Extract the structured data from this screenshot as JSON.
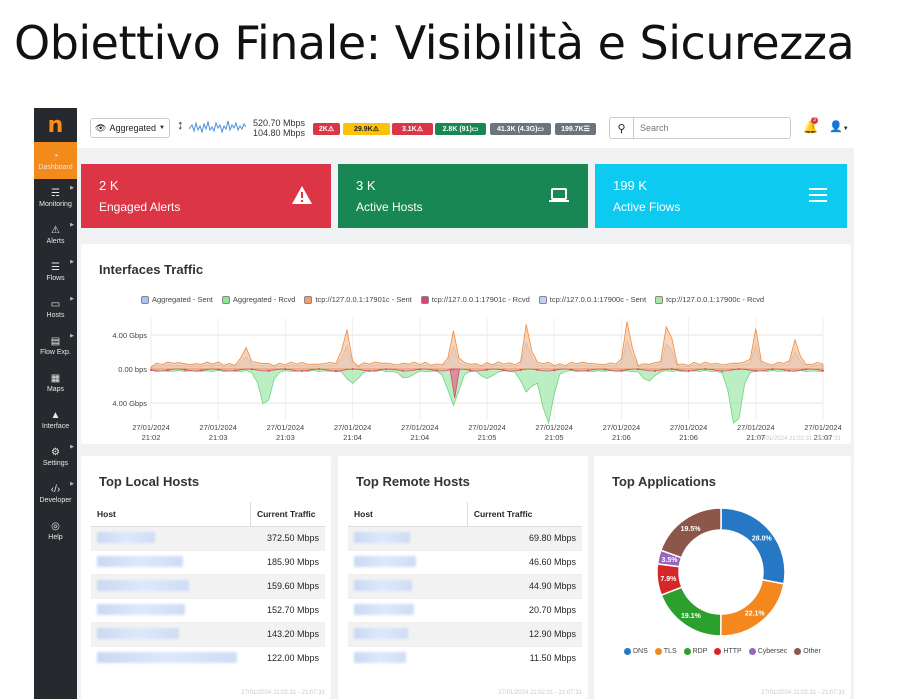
{
  "slide_title": "Obiettivo Finale: Visibilità e Sicurezza",
  "sidebar": {
    "logo": "n",
    "items": [
      {
        "label": "Dashboard",
        "icon": "gauge-icon",
        "active": true
      },
      {
        "label": "Monitoring",
        "icon": "monitoring-icon"
      },
      {
        "label": "Alerts",
        "icon": "warning-icon"
      },
      {
        "label": "Flows",
        "icon": "flows-icon"
      },
      {
        "label": "Hosts",
        "icon": "laptop-icon"
      },
      {
        "label": "Flow Exp.",
        "icon": "file-export-icon"
      },
      {
        "label": "Maps",
        "icon": "map-icon"
      },
      {
        "label": "Interface",
        "icon": "ethernet-icon"
      },
      {
        "label": "Settings",
        "icon": "cog-icon"
      },
      {
        "label": "Developer",
        "icon": "code-icon"
      },
      {
        "label": "Help",
        "icon": "life-ring-icon"
      }
    ]
  },
  "topbar": {
    "interface_selector": "Aggregated",
    "upload": "520.70 Mbps",
    "download": "104.80 Mbps",
    "badges": [
      {
        "label": "2K",
        "icon": "warning-icon",
        "color": "#dc3545"
      },
      {
        "label": "29.9K",
        "icon": "warning-icon",
        "color": "#ffc107"
      },
      {
        "label": "3.1K",
        "icon": "warning-icon",
        "color": "#dc3545"
      },
      {
        "label": "2.8K (91)",
        "icon": "laptop-icon",
        "color": "#198754"
      },
      {
        "label": "41.3K (4.3G)",
        "icon": "laptop-icon",
        "color": "#6c757d"
      },
      {
        "label": "199.7K",
        "icon": "flows-icon",
        "color": "#6c757d"
      }
    ],
    "search_placeholder": "Search",
    "notifications": "3"
  },
  "stats": [
    {
      "value": "2 K",
      "label": "Engaged Alerts",
      "color": "#dc3545",
      "icon": "warning-icon"
    },
    {
      "value": "3 K",
      "label": "Active Hosts",
      "color": "#198754",
      "icon": "laptop-icon"
    },
    {
      "value": "199 K",
      "label": "Active Flows",
      "color": "#0dcaf0",
      "icon": "flows-icon"
    }
  ],
  "traffic": {
    "title": "Interfaces Traffic",
    "footer": "27/01/2024 21:02:31 - 21:07:31",
    "chart_data": {
      "type": "area",
      "series": [
        {
          "name": "Aggregated - Sent",
          "color": "#a8c4f0"
        },
        {
          "name": "Aggregated - Rcvd",
          "color": "#8fe39b"
        },
        {
          "name": "tcp://127.0.0.1:17901c - Sent",
          "color": "#f2a065"
        },
        {
          "name": "tcp://127.0.0.1:17901c - Rcvd",
          "color": "#d9456f"
        },
        {
          "name": "tcp://127.0.0.1:17900c - Sent",
          "color": "#bcd3f5"
        },
        {
          "name": "tcp://127.0.0.1:17900c - Rcvd",
          "color": "#a3eaa8"
        }
      ],
      "y_ticks": [
        "4.00 Gbps",
        "0.00 bps",
        "4.00 Gbps"
      ],
      "x_ticks": [
        [
          "27/01/2024",
          "21:02"
        ],
        [
          "27/01/2024",
          "21:03"
        ],
        [
          "27/01/2024",
          "21:03"
        ],
        [
          "27/01/2024",
          "21:04"
        ],
        [
          "27/01/2024",
          "21:04"
        ],
        [
          "27/01/2024",
          "21:05"
        ],
        [
          "27/01/2024",
          "21:05"
        ],
        [
          "27/01/2024",
          "21:06"
        ],
        [
          "27/01/2024",
          "21:06"
        ],
        [
          "27/01/2024",
          "21:07"
        ],
        [
          "27/01/2024",
          "21:07"
        ]
      ],
      "ylim": [
        -6,
        6
      ],
      "sent_peaks": [
        [
          0.14,
          2.0
        ],
        [
          0.29,
          4.5
        ],
        [
          0.45,
          3.8
        ],
        [
          0.56,
          5.0
        ],
        [
          0.71,
          5.5
        ],
        [
          0.77,
          5.8
        ],
        [
          0.9,
          4.0
        ],
        [
          0.96,
          3.0
        ]
      ],
      "rcvd_troughs": [
        [
          0.17,
          -4.2
        ],
        [
          0.3,
          -1.5
        ],
        [
          0.38,
          -0.9
        ],
        [
          0.45,
          -4.0
        ],
        [
          0.5,
          -0.9
        ],
        [
          0.56,
          -2.5
        ],
        [
          0.59,
          -6.2
        ],
        [
          0.74,
          -1.2
        ],
        [
          0.87,
          -6.8
        ]
      ]
    }
  },
  "local_hosts": {
    "title": "Top Local Hosts",
    "col_host": "Host",
    "col_traffic": "Current Traffic",
    "rows": [
      "372.50 Mbps",
      "185.90 Mbps",
      "159.60 Mbps",
      "152.70 Mbps",
      "143.20 Mbps",
      "122.00 Mbps"
    ],
    "footer": "27/01/2024 21:02:31 - 21:07:31"
  },
  "remote_hosts": {
    "title": "Top Remote Hosts",
    "col_host": "Host",
    "col_traffic": "Current Traffic",
    "rows": [
      "69.80 Mbps",
      "46.60 Mbps",
      "44.90 Mbps",
      "20.70 Mbps",
      "12.90 Mbps",
      "11.50 Mbps"
    ],
    "footer": "27/01/2024 21:02:31 - 21:07:31"
  },
  "apps": {
    "title": "Top Applications",
    "footer": "27/01/2024 21:02:31 - 21:07:31",
    "chart_data": {
      "type": "pie",
      "slices": [
        {
          "name": "DNS",
          "value": 28.0,
          "label": "28.0%",
          "color": "#2778c4"
        },
        {
          "name": "TLS",
          "value": 22.1,
          "label": "22.1%",
          "color": "#f4871e"
        },
        {
          "name": "RDP",
          "value": 19.1,
          "label": "19.1%",
          "color": "#2ca02c"
        },
        {
          "name": "HTTP",
          "value": 7.9,
          "label": "7.9%",
          "color": "#d62728"
        },
        {
          "name": "Cybersec",
          "value": 3.5,
          "label": "3.5%",
          "color": "#9467bd"
        },
        {
          "name": "Other",
          "value": 19.5,
          "label": "19.5%",
          "color": "#8c564b"
        }
      ]
    }
  }
}
